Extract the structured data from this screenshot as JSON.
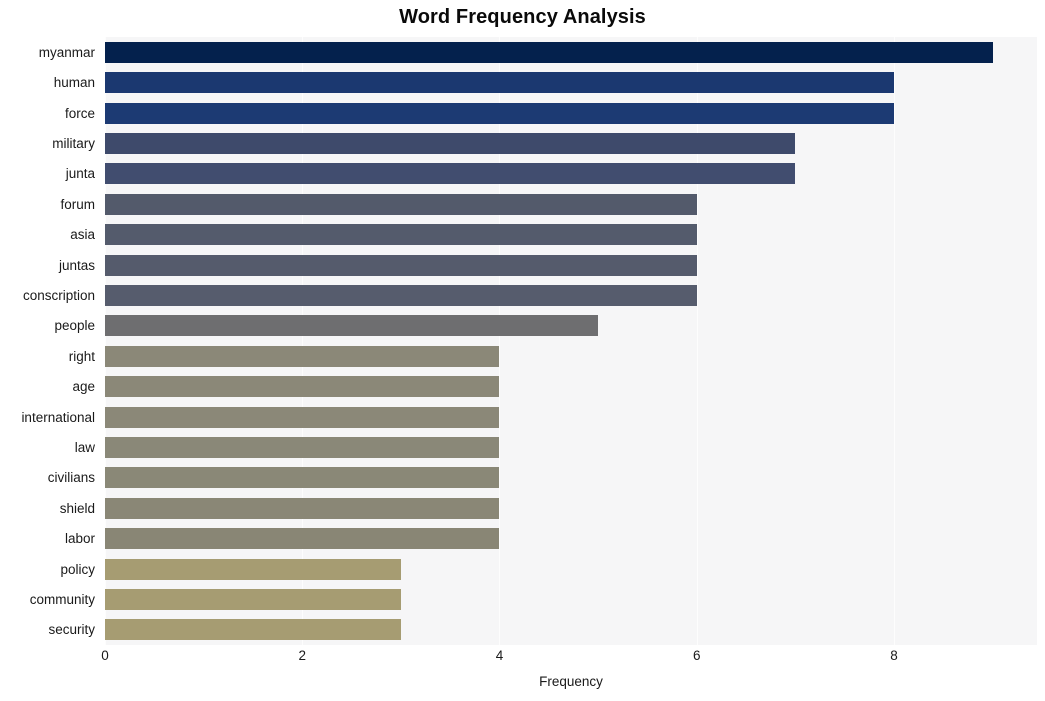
{
  "chart_data": {
    "type": "bar",
    "orientation": "horizontal",
    "title": "Word Frequency Analysis",
    "xlabel": "Frequency",
    "ylabel": "",
    "xlim": [
      0,
      9.45
    ],
    "ylim": [
      0,
      20
    ],
    "grid": true,
    "legend": false,
    "legend_position": "none",
    "xticks": [
      0,
      2,
      4,
      6,
      8
    ],
    "xtick_labels": [
      "0",
      "2",
      "4",
      "6",
      "8"
    ],
    "categories": [
      "myanmar",
      "human",
      "force",
      "military",
      "junta",
      "forum",
      "asia",
      "juntas",
      "conscription",
      "people",
      "right",
      "age",
      "international",
      "law",
      "civilians",
      "shield",
      "labor",
      "policy",
      "community",
      "security"
    ],
    "values": [
      9,
      8,
      8,
      7,
      7,
      6,
      6,
      6,
      6,
      5,
      4,
      4,
      4,
      4,
      4,
      4,
      4,
      3,
      3,
      3
    ],
    "bar_colors": [
      "#04214d",
      "#1b3870",
      "#1c3a73",
      "#3e4a6b",
      "#414d6f",
      "#535a6b",
      "#545b6c",
      "#555b6c",
      "#565c6d",
      "#6e6e70",
      "#8b8878",
      "#8b8878",
      "#8b8878",
      "#8a8878",
      "#8a8877",
      "#8a8776",
      "#898675",
      "#a69c72",
      "#a69c72",
      "#a69c72"
    ],
    "plot_background": "#f6f6f7",
    "gridline_color": "#fdfdfd",
    "text_color": "#1a1a1a"
  }
}
